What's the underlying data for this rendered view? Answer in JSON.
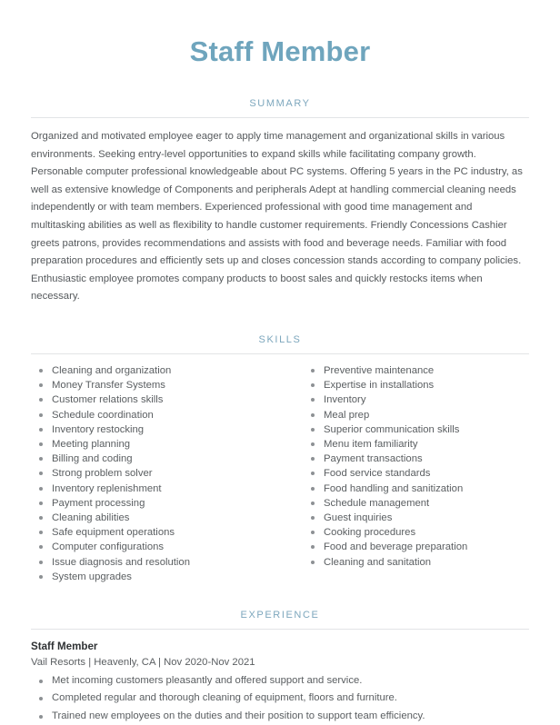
{
  "document": {
    "title": "Staff Member"
  },
  "sections": {
    "summary": {
      "heading": "SUMMARY",
      "text": "Organized and motivated employee eager to apply time management and organizational skills in various environments. Seeking entry-level opportunities to expand skills while facilitating company growth. Personable computer professional knowledgeable about PC systems. Offering 5 years in the PC industry, as well as extensive knowledge of Components and peripherals Adept at handling commercial cleaning needs independently or with team members. Experienced professional with good time management and multitasking abilities as well as flexibility to handle customer requirements. Friendly Concessions Cashier greets patrons, provides recommendations and assists with food and beverage needs. Familiar with food preparation procedures and efficiently sets up and closes concession stands according to company policies. Enthusiastic employee promotes company products to boost sales and quickly restocks items when necessary."
    },
    "skills": {
      "heading": "SKILLS",
      "left_column": [
        "Cleaning and organization",
        "Money Transfer Systems",
        "Customer relations skills",
        "Schedule coordination",
        "Inventory restocking",
        "Meeting planning",
        "Billing and coding",
        "Strong problem solver",
        "Inventory replenishment",
        "Payment processing",
        "Cleaning abilities",
        "Safe equipment operations",
        "Computer configurations",
        "Issue diagnosis and resolution",
        "System upgrades"
      ],
      "right_column": [
        "Preventive maintenance",
        "Expertise in installations",
        "Inventory",
        "Meal prep",
        "Superior communication skills",
        "Menu item familiarity",
        "Payment transactions",
        "Food service standards",
        "Food handling and sanitization",
        "Schedule management",
        "Guest inquiries",
        "Cooking procedures",
        "Food and beverage preparation",
        "Cleaning and sanitation"
      ]
    },
    "experience": {
      "heading": "EXPERIENCE",
      "jobs": [
        {
          "title": "Staff Member",
          "meta": "Vail Resorts | Heavenly, CA | Nov 2020-Nov 2021",
          "bullets": [
            "Met incoming customers pleasantly and offered support and service.",
            "Completed regular and thorough cleaning of equipment, floors and furniture.",
            "Trained new employees on the duties and their position to support team efficiency."
          ]
        }
      ]
    }
  },
  "colors": {
    "title": "#6fa5bd",
    "section_heading": "#7da7bd",
    "body_text": "#55595c",
    "rule": "#e2e4e6",
    "bullet": "#8d9194"
  }
}
